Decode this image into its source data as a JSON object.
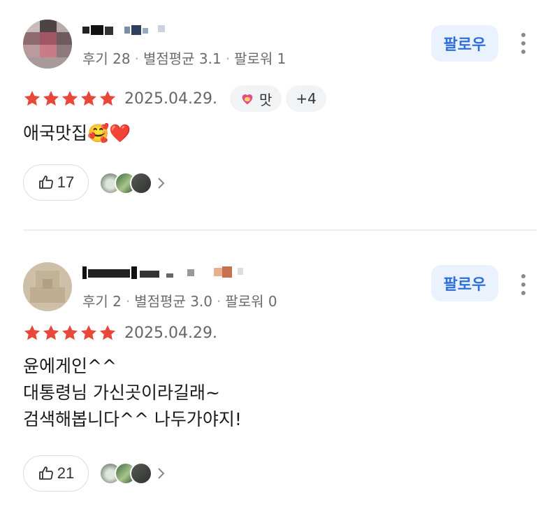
{
  "reviews": [
    {
      "meta": {
        "reviews": "후기 28",
        "avg": "별점평균 3.1",
        "followers": "팔로워 1"
      },
      "follow_label": "팔로우",
      "rating": 5,
      "date": "2025.04.29.",
      "tags": [
        {
          "icon": "heart-face-icon",
          "label": "맛"
        },
        {
          "label": "+4"
        }
      ],
      "text": "애국맛집🥰❤️",
      "likes": "17",
      "photo_icons": [
        "photo-thumb",
        "photo-thumb",
        "photo-thumb"
      ]
    },
    {
      "meta": {
        "reviews": "후기 2",
        "avg": "별점평균 3.0",
        "followers": "팔로워 0"
      },
      "follow_label": "팔로우",
      "rating": 5,
      "date": "2025.04.29.",
      "text": "윤에게인^^\n대통령님 가신곳이라길래~\n검색해봅니다^^ 나두가야지!",
      "likes": "21",
      "photo_icons": [
        "photo-thumb",
        "photo-thumb",
        "photo-thumb"
      ]
    }
  ],
  "colors": {
    "star": "#e8473a",
    "follow_bg": "#eaf2fd",
    "follow_text": "#2f6fdc",
    "heart_tag": "#e8488f"
  }
}
